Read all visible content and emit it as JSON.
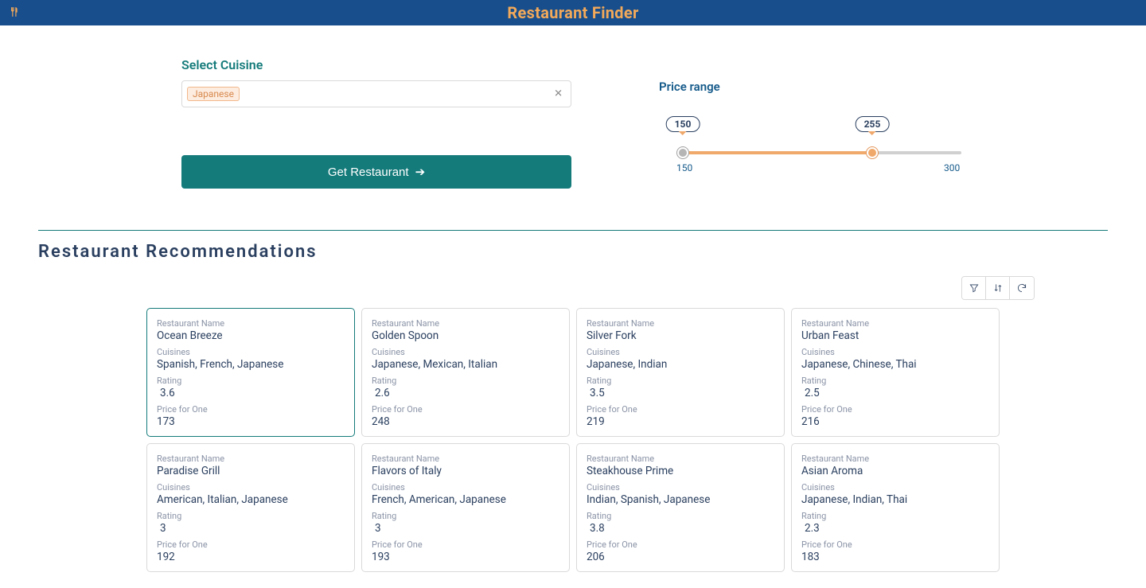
{
  "header": {
    "title": "Restaurant Finder"
  },
  "cuisine": {
    "label": "Select Cuisine",
    "selected_chip": "Japanese"
  },
  "price": {
    "label": "Price range",
    "min": 150,
    "max": 300,
    "value_low": 150,
    "value_high": 255
  },
  "action": {
    "get_label": "Get Restaurant"
  },
  "recommendations": {
    "heading": "Restaurant Recommendations",
    "field_labels": {
      "name": "Restaurant Name",
      "cuisines": "Cuisines",
      "rating": "Rating",
      "price": "Price for One"
    },
    "items": [
      {
        "name": "Ocean Breeze",
        "cuisines": "Spanish, French, Japanese",
        "rating": "3.6",
        "price": "173",
        "selected": true
      },
      {
        "name": "Golden Spoon",
        "cuisines": "Japanese, Mexican, Italian",
        "rating": "2.6",
        "price": "248",
        "selected": false
      },
      {
        "name": "Silver Fork",
        "cuisines": "Japanese, Indian",
        "rating": "3.5",
        "price": "219",
        "selected": false
      },
      {
        "name": "Urban Feast",
        "cuisines": "Japanese, Chinese, Thai",
        "rating": "2.5",
        "price": "216",
        "selected": false
      },
      {
        "name": "Paradise Grill",
        "cuisines": "American, Italian, Japanese",
        "rating": "3",
        "price": "192",
        "selected": false
      },
      {
        "name": "Flavors of Italy",
        "cuisines": "French, American, Japanese",
        "rating": "3",
        "price": "193",
        "selected": false
      },
      {
        "name": "Steakhouse Prime",
        "cuisines": "Indian, Spanish, Japanese",
        "rating": "3.8",
        "price": "206",
        "selected": false
      },
      {
        "name": "Asian Aroma",
        "cuisines": "Japanese, Indian, Thai",
        "rating": "2.3",
        "price": "183",
        "selected": false
      }
    ]
  }
}
